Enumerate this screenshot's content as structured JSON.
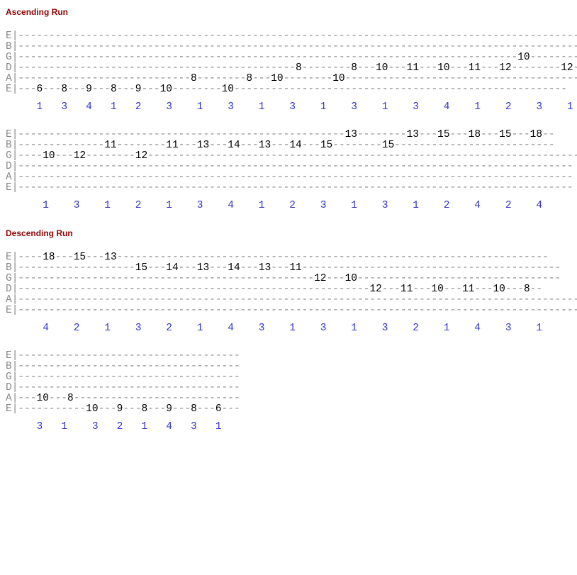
{
  "headings": {
    "ascending": "Ascending Run",
    "descending": "Descending Run"
  },
  "tuning": [
    "E",
    "B",
    "G",
    "D",
    "A",
    "E"
  ],
  "ascending": {
    "lines": [
      {
        "tab": {
          "E": [],
          "B": [],
          "G": [
            null,
            null,
            null,
            null,
            null,
            null,
            null,
            null,
            null,
            null,
            null,
            null,
            null,
            null,
            null,
            null,
            null,
            null,
            10,
            null
          ],
          "D": [
            null,
            null,
            null,
            null,
            null,
            null,
            null,
            null,
            null,
            null,
            8,
            null,
            8,
            10,
            11,
            10,
            11,
            12,
            null,
            12
          ],
          "A": [
            null,
            null,
            null,
            null,
            null,
            null,
            8,
            null,
            8,
            10,
            null,
            10,
            null,
            null,
            null,
            null,
            null,
            null,
            null,
            null
          ],
          "E2": [
            6,
            8,
            9,
            8,
            9,
            10,
            null,
            10,
            null,
            null,
            null,
            null,
            null,
            null,
            null,
            null,
            null,
            null,
            null,
            null
          ]
        },
        "fingers": [
          1,
          3,
          4,
          1,
          2,
          3,
          1,
          3,
          1,
          3,
          1,
          3,
          1,
          3,
          4,
          1,
          2,
          3,
          1,
          3
        ]
      },
      {
        "tab": {
          "E": [
            null,
            null,
            null,
            null,
            null,
            null,
            null,
            null,
            null,
            null,
            null,
            null,
            13,
            null,
            13,
            15,
            18,
            15,
            18,
            null
          ],
          "B": [
            null,
            null,
            11,
            null,
            11,
            13,
            14,
            13,
            14,
            15,
            null,
            15,
            null,
            null,
            null,
            null,
            null,
            null,
            null,
            null
          ],
          "G": [
            10,
            12,
            null,
            12,
            null,
            null,
            null,
            null,
            null,
            null,
            null,
            null,
            null,
            null,
            null,
            null,
            null,
            null,
            null,
            null
          ],
          "D": [],
          "A": [],
          "E2": []
        },
        "fingers": [
          1,
          3,
          1,
          2,
          1,
          3,
          4,
          1,
          2,
          3,
          1,
          3,
          1,
          2,
          4,
          2,
          4,
          null,
          null,
          null
        ]
      }
    ]
  },
  "descending": {
    "lines": [
      {
        "tab": {
          "E": [
            18,
            15,
            13,
            null,
            null,
            null,
            null,
            null,
            null,
            null,
            null,
            null,
            null,
            null,
            null,
            null,
            null
          ],
          "B": [
            null,
            null,
            null,
            15,
            14,
            13,
            14,
            13,
            11,
            null,
            null,
            null,
            null,
            null,
            null,
            null,
            null
          ],
          "G": [
            null,
            null,
            null,
            null,
            null,
            null,
            null,
            null,
            null,
            12,
            10,
            null,
            null,
            null,
            null,
            null,
            null
          ],
          "D": [
            null,
            null,
            null,
            null,
            null,
            null,
            null,
            null,
            null,
            null,
            null,
            12,
            11,
            10,
            11,
            10,
            8
          ],
          "A": [],
          "E2": []
        },
        "fingers": [
          4,
          2,
          1,
          3,
          2,
          1,
          4,
          3,
          1,
          3,
          1,
          3,
          2,
          1,
          4,
          3,
          1
        ]
      },
      {
        "tab": {
          "E": [],
          "B": [],
          "G": [],
          "D": [],
          "A": [
            10,
            8,
            null,
            null,
            null,
            null,
            null,
            null
          ],
          "E2": [
            null,
            null,
            10,
            9,
            8,
            9,
            8,
            6
          ]
        },
        "fingers": [
          3,
          1,
          3,
          2,
          1,
          4,
          3,
          1
        ]
      }
    ]
  },
  "chart_data": {
    "type": "table",
    "title": "Guitar Tab — Ascending and Descending Runs",
    "sections": [
      {
        "name": "Ascending Run",
        "rows": [
          {
            "notes": [
              {
                "string": "E",
                "fret": 6,
                "finger": 1
              },
              {
                "string": "E",
                "fret": 8,
                "finger": 3
              },
              {
                "string": "E",
                "fret": 9,
                "finger": 4
              },
              {
                "string": "E",
                "fret": 8,
                "finger": 1
              },
              {
                "string": "E",
                "fret": 9,
                "finger": 2
              },
              {
                "string": "E",
                "fret": 10,
                "finger": 3
              },
              {
                "string": "A",
                "fret": 8,
                "finger": 1
              },
              {
                "string": "E",
                "fret": 10,
                "finger": 3
              },
              {
                "string": "A",
                "fret": 8,
                "finger": 1
              },
              {
                "string": "A",
                "fret": 10,
                "finger": 3
              },
              {
                "string": "D",
                "fret": 8,
                "finger": 1
              },
              {
                "string": "A",
                "fret": 10,
                "finger": 3
              },
              {
                "string": "D",
                "fret": 8,
                "finger": 1
              },
              {
                "string": "D",
                "fret": 10,
                "finger": 3
              },
              {
                "string": "D",
                "fret": 11,
                "finger": 4
              },
              {
                "string": "D",
                "fret": 10,
                "finger": 1
              },
              {
                "string": "D",
                "fret": 11,
                "finger": 2
              },
              {
                "string": "D",
                "fret": 12,
                "finger": 3
              },
              {
                "string": "G",
                "fret": 10,
                "finger": 1
              },
              {
                "string": "D",
                "fret": 12,
                "finger": 3
              }
            ]
          },
          {
            "notes": [
              {
                "string": "G",
                "fret": 10,
                "finger": 1
              },
              {
                "string": "G",
                "fret": 12,
                "finger": 3
              },
              {
                "string": "B",
                "fret": 11,
                "finger": 1
              },
              {
                "string": "G",
                "fret": 12,
                "finger": 2
              },
              {
                "string": "B",
                "fret": 11,
                "finger": 1
              },
              {
                "string": "B",
                "fret": 13,
                "finger": 3
              },
              {
                "string": "B",
                "fret": 14,
                "finger": 4
              },
              {
                "string": "B",
                "fret": 13,
                "finger": 1
              },
              {
                "string": "B",
                "fret": 14,
                "finger": 2
              },
              {
                "string": "B",
                "fret": 15,
                "finger": 3
              },
              {
                "string": "e",
                "fret": 13,
                "finger": 1
              },
              {
                "string": "B",
                "fret": 15,
                "finger": 3
              },
              {
                "string": "e",
                "fret": 13,
                "finger": 1
              },
              {
                "string": "e",
                "fret": 15,
                "finger": 2
              },
              {
                "string": "e",
                "fret": 18,
                "finger": 4
              },
              {
                "string": "e",
                "fret": 15,
                "finger": 2
              },
              {
                "string": "e",
                "fret": 18,
                "finger": 4
              }
            ]
          }
        ]
      },
      {
        "name": "Descending Run",
        "rows": [
          {
            "notes": [
              {
                "string": "e",
                "fret": 18,
                "finger": 4
              },
              {
                "string": "e",
                "fret": 15,
                "finger": 2
              },
              {
                "string": "e",
                "fret": 13,
                "finger": 1
              },
              {
                "string": "B",
                "fret": 15,
                "finger": 3
              },
              {
                "string": "B",
                "fret": 14,
                "finger": 2
              },
              {
                "string": "B",
                "fret": 13,
                "finger": 1
              },
              {
                "string": "B",
                "fret": 14,
                "finger": 4
              },
              {
                "string": "B",
                "fret": 13,
                "finger": 3
              },
              {
                "string": "B",
                "fret": 11,
                "finger": 1
              },
              {
                "string": "G",
                "fret": 12,
                "finger": 3
              },
              {
                "string": "G",
                "fret": 10,
                "finger": 1
              },
              {
                "string": "D",
                "fret": 12,
                "finger": 3
              },
              {
                "string": "D",
                "fret": 11,
                "finger": 2
              },
              {
                "string": "D",
                "fret": 10,
                "finger": 1
              },
              {
                "string": "D",
                "fret": 11,
                "finger": 4
              },
              {
                "string": "D",
                "fret": 10,
                "finger": 3
              },
              {
                "string": "D",
                "fret": 8,
                "finger": 1
              }
            ]
          },
          {
            "notes": [
              {
                "string": "A",
                "fret": 10,
                "finger": 3
              },
              {
                "string": "A",
                "fret": 8,
                "finger": 1
              },
              {
                "string": "E",
                "fret": 10,
                "finger": 3
              },
              {
                "string": "E",
                "fret": 9,
                "finger": 2
              },
              {
                "string": "E",
                "fret": 8,
                "finger": 1
              },
              {
                "string": "E",
                "fret": 9,
                "finger": 4
              },
              {
                "string": "E",
                "fret": 8,
                "finger": 3
              },
              {
                "string": "E",
                "fret": 6,
                "finger": 1
              }
            ]
          }
        ]
      }
    ]
  }
}
